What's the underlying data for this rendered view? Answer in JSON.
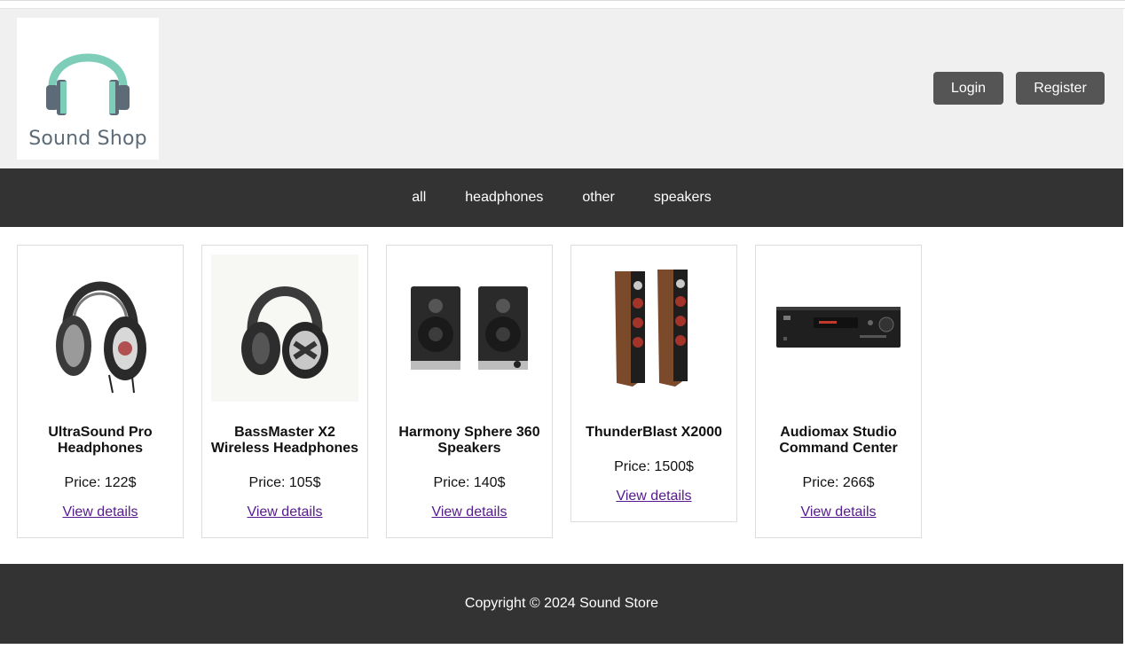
{
  "logo": {
    "text": "Sound Shop",
    "icon": "headphones-logo-icon"
  },
  "header": {
    "login_label": "Login",
    "register_label": "Register"
  },
  "nav": {
    "items": [
      "all",
      "headphones",
      "other",
      "speakers"
    ]
  },
  "products": [
    {
      "name": "UltraSound Pro Headphones",
      "price": "Price: 122$",
      "link": "View details",
      "image": "headphones-image"
    },
    {
      "name": "BassMaster X2 Wireless Headphones",
      "price": "Price: 105$",
      "link": "View details",
      "image": "headphones-image"
    },
    {
      "name": "Harmony Sphere 360 Speakers",
      "price": "Price: 140$",
      "link": "View details",
      "image": "bookshelf-speakers-image"
    },
    {
      "name": "ThunderBlast X2000",
      "price": "Price: 1500$",
      "link": "View details",
      "image": "tower-speakers-image"
    },
    {
      "name": "Audiomax Studio Command Center",
      "price": "Price: 266$",
      "link": "View details",
      "image": "receiver-image"
    }
  ],
  "footer": {
    "copyright": "Copyright © 2024 Sound Store"
  },
  "colors": {
    "header_bg": "#f0f0f0",
    "nav_bg": "#333333",
    "button_bg": "#555555",
    "link": "#551a8b",
    "logo_teal": "#7ecdb9"
  }
}
